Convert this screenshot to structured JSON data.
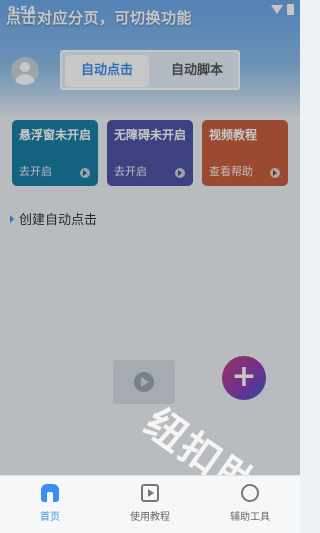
{
  "status_bar": {
    "time": "9:54"
  },
  "hint": "点击对应分页，可切换功能",
  "tabs": [
    {
      "label": "自动点击",
      "active": true
    },
    {
      "label": "自动脚本",
      "active": false
    }
  ],
  "cards": [
    {
      "title": "悬浮窗未开启",
      "sub": "去开启",
      "color": "#1b7ea4"
    },
    {
      "title": "无障碍未开启",
      "sub": "去开启",
      "color": "#4e55a6"
    },
    {
      "title": "视频教程",
      "sub": "查看帮助",
      "color": "#c65f3f"
    }
  ],
  "section": {
    "title": "创建自动点击"
  },
  "fab": {
    "label": "+"
  },
  "watermark": "纽扣助手",
  "bottom_nav": [
    {
      "label": "首页",
      "icon": "home-icon",
      "active": true
    },
    {
      "label": "使用教程",
      "icon": "video-icon",
      "active": false
    },
    {
      "label": "辅助工具",
      "icon": "tools-icon",
      "active": false
    }
  ],
  "colors": {
    "accent": "#3b8ff0"
  }
}
